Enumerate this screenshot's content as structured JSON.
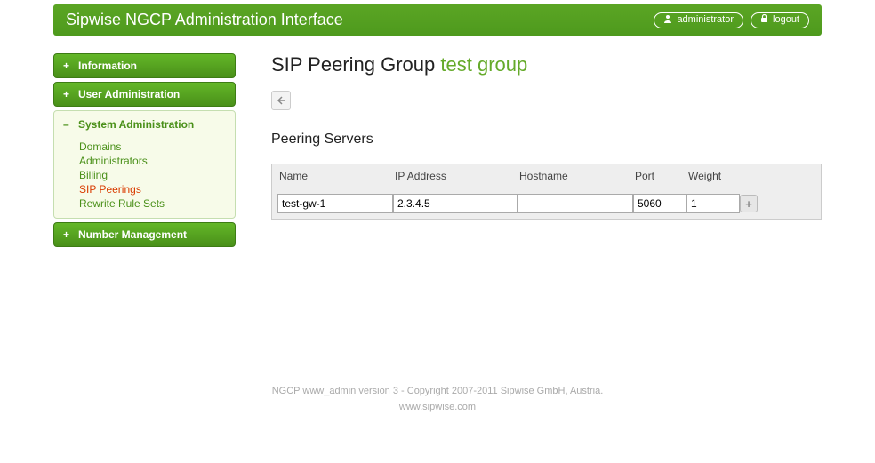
{
  "header": {
    "title": "Sipwise NGCP Administration Interface",
    "user_btn": "administrator",
    "logout_btn": "logout"
  },
  "sidebar": {
    "items": [
      {
        "label": "Information",
        "expanded": false
      },
      {
        "label": "User Administration",
        "expanded": false
      },
      {
        "label": "System Administration",
        "expanded": true,
        "subitems": [
          {
            "label": "Domains",
            "active": false
          },
          {
            "label": "Administrators",
            "active": false
          },
          {
            "label": "Billing",
            "active": false
          },
          {
            "label": "SIP Peerings",
            "active": true
          },
          {
            "label": "Rewrite Rule Sets",
            "active": false
          }
        ]
      },
      {
        "label": "Number Management",
        "expanded": false
      }
    ]
  },
  "main": {
    "title_prefix": "SIP Peering Group",
    "group_name": "test group",
    "section_title": "Peering Servers",
    "columns": {
      "name": "Name",
      "ip": "IP Address",
      "host": "Hostname",
      "port": "Port",
      "weight": "Weight"
    },
    "row": {
      "name": "test-gw-1",
      "ip": "2.3.4.5",
      "host": "",
      "port": "5060",
      "weight": "1"
    }
  },
  "footer": {
    "line1": "NGCP www_admin version 3 - Copyright 2007-2011 Sipwise GmbH, Austria.",
    "line2": "www.sipwise.com"
  }
}
